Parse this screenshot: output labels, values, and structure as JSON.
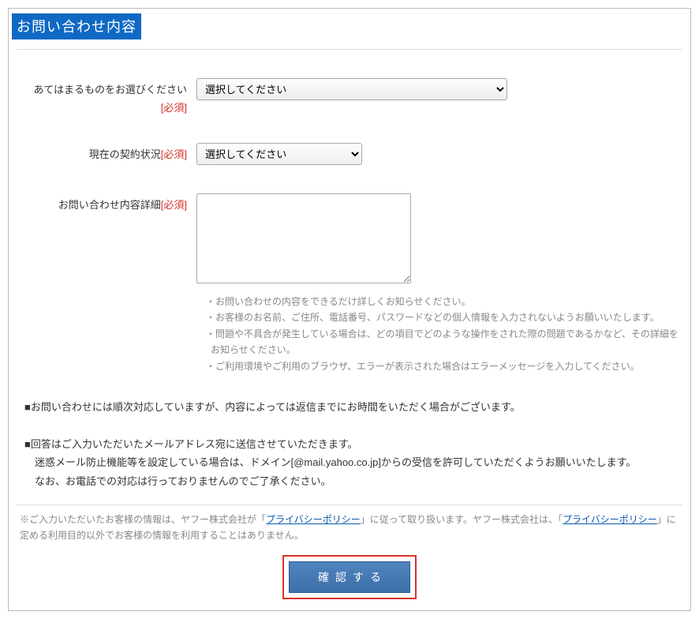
{
  "section_title": "お問い合わせ内容",
  "required_label": "[必須]",
  "fields": {
    "category": {
      "label": "あてはまるものをお選びください",
      "placeholder_option": "選択してください"
    },
    "contract": {
      "label": "現在の契約状況",
      "placeholder_option": "選択してください"
    },
    "detail": {
      "label": "お問い合わせ内容詳細"
    }
  },
  "detail_notes": [
    "・お問い合わせの内容をできるだけ詳しくお知らせください。",
    "・お客様のお名前、ご住所、電話番号、パスワードなどの個人情報を入力されないようお願いいたします。",
    "・問題や不具合が発生している場合は、どの項目でどのような操作をされた際の問題であるかなど、その詳細をお知らせください。",
    "・ご利用環境やご利用のブラウザ、エラーが表示された場合はエラーメッセージを入力してください。"
  ],
  "info": {
    "line1": "■お問い合わせには順次対応していますが、内容によっては返信までにお時間をいただく場合がございます。",
    "line2": "■回答はご入力いただいたメールアドレス宛に送信させていただきます。",
    "line3": "迷惑メール防止機能等を設定している場合は、ドメイン[@mail.yahoo.co.jp]からの受信を許可していただくようお願いいたします。",
    "line4": "なお、お電話での対応は行っておりませんのでご了承ください。"
  },
  "privacy": {
    "pre1": "※ご入力いただいたお客様の情報は、ヤフー株式会社が「",
    "link1": "プライバシーポリシー",
    "mid1": "」に従って取り扱います。ヤフー株式会社は、「",
    "link2": "プライバシーポリシー",
    "post1": "」に定める利用目的以外でお客様の情報を利用することはありません。"
  },
  "confirm_button": "確認する"
}
